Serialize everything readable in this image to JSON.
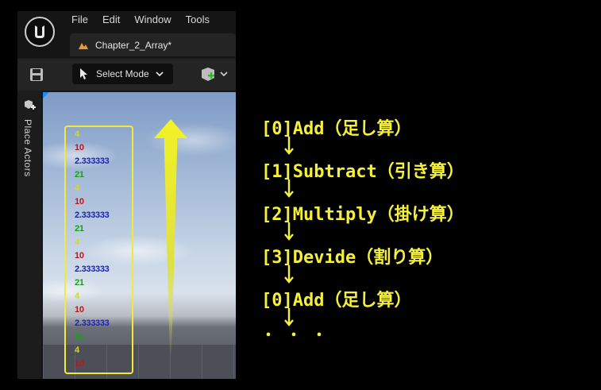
{
  "menu": {
    "items": [
      "File",
      "Edit",
      "Window",
      "Tools"
    ]
  },
  "level_tab": {
    "label": "Chapter_2_Array*"
  },
  "toolbar": {
    "select_mode_label": "Select Mode"
  },
  "side_panel": {
    "label": "Place Actors"
  },
  "log": {
    "lines": [
      {
        "text": "4",
        "color": "#d6d62a"
      },
      {
        "text": "10",
        "color": "#c0141c"
      },
      {
        "text": "2.333333",
        "color": "#1e22b8"
      },
      {
        "text": "21",
        "color": "#1a9e1a"
      },
      {
        "text": "4",
        "color": "#d6d62a"
      },
      {
        "text": "10",
        "color": "#c0141c"
      },
      {
        "text": "2.333333",
        "color": "#1e22b8"
      },
      {
        "text": "21",
        "color": "#1a9e1a"
      },
      {
        "text": "4",
        "color": "#d6d62a"
      },
      {
        "text": "10",
        "color": "#c0141c"
      },
      {
        "text": "2.333333",
        "color": "#1e22b8"
      },
      {
        "text": "21",
        "color": "#1a9e1a"
      },
      {
        "text": "4",
        "color": "#d6d62a"
      },
      {
        "text": "10",
        "color": "#c0141c"
      },
      {
        "text": "2.333333",
        "color": "#1e22b8"
      },
      {
        "text": "21",
        "color": "#1a9e1a"
      },
      {
        "text": "4",
        "color": "#d6d62a"
      },
      {
        "text": "10",
        "color": "#c0141c"
      }
    ]
  },
  "flow": {
    "steps": [
      "[0]Add（足し算）",
      "[1]Subtract（引き算）",
      "[2]Multiply（掛け算）",
      "[3]Devide（割り算）",
      "[0]Add（足し算）"
    ],
    "ellipsis": "・・・"
  },
  "colors": {
    "annotation": "#f5f03c",
    "log_box_border": "#f2ea37",
    "editor_bg": "#151515",
    "toolbar_bg": "#242424"
  },
  "icons": {
    "logo": "unreal-logo-icon",
    "level_tab": "level-map-icon",
    "save": "save-icon",
    "select_mode": "cursor-icon",
    "chevron": "chevron-down-icon",
    "place_actors": "place-actor-icon"
  }
}
